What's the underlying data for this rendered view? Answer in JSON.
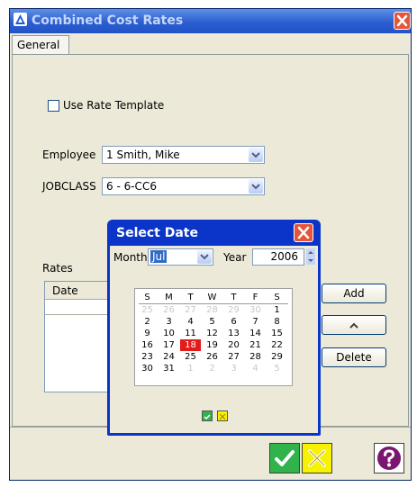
{
  "window": {
    "title": "Combined Cost Rates"
  },
  "tabs": [
    {
      "label": "General"
    }
  ],
  "form": {
    "use_rate_template_label": "Use Rate Template",
    "employee_label": "Employee",
    "employee_value": "1 Smith, Mike",
    "jobclass_label": "JOBCLASS",
    "jobclass_value": "6 - 6-CC6",
    "rates_label": "Rates",
    "rates_table": {
      "columns": [
        "Date"
      ]
    }
  },
  "buttons": {
    "add": "Add",
    "up": "^",
    "delete": "Delete"
  },
  "date_picker": {
    "title": "Select Date",
    "month_label": "Month",
    "month_value": "Jul",
    "year_label": "Year",
    "year_value": "2006",
    "weekday_headers": [
      "S",
      "M",
      "T",
      "W",
      "T",
      "F",
      "S"
    ],
    "weeks": [
      [
        "25",
        "26",
        "27",
        "28",
        "29",
        "30",
        "1"
      ],
      [
        "2",
        "3",
        "4",
        "5",
        "6",
        "7",
        "8"
      ],
      [
        "9",
        "10",
        "11",
        "12",
        "13",
        "14",
        "15"
      ],
      [
        "16",
        "17",
        "18",
        "19",
        "20",
        "21",
        "22"
      ],
      [
        "23",
        "24",
        "25",
        "26",
        "27",
        "28",
        "29"
      ],
      [
        "30",
        "31",
        "1",
        "2",
        "3",
        "4",
        "5"
      ]
    ],
    "selected_day": "18"
  },
  "colors": {
    "accent": "#0a35c8",
    "ok": "#2fb34a",
    "cancel": "#f7f300",
    "help": "#7a1570",
    "selected": "#e21b1b"
  }
}
